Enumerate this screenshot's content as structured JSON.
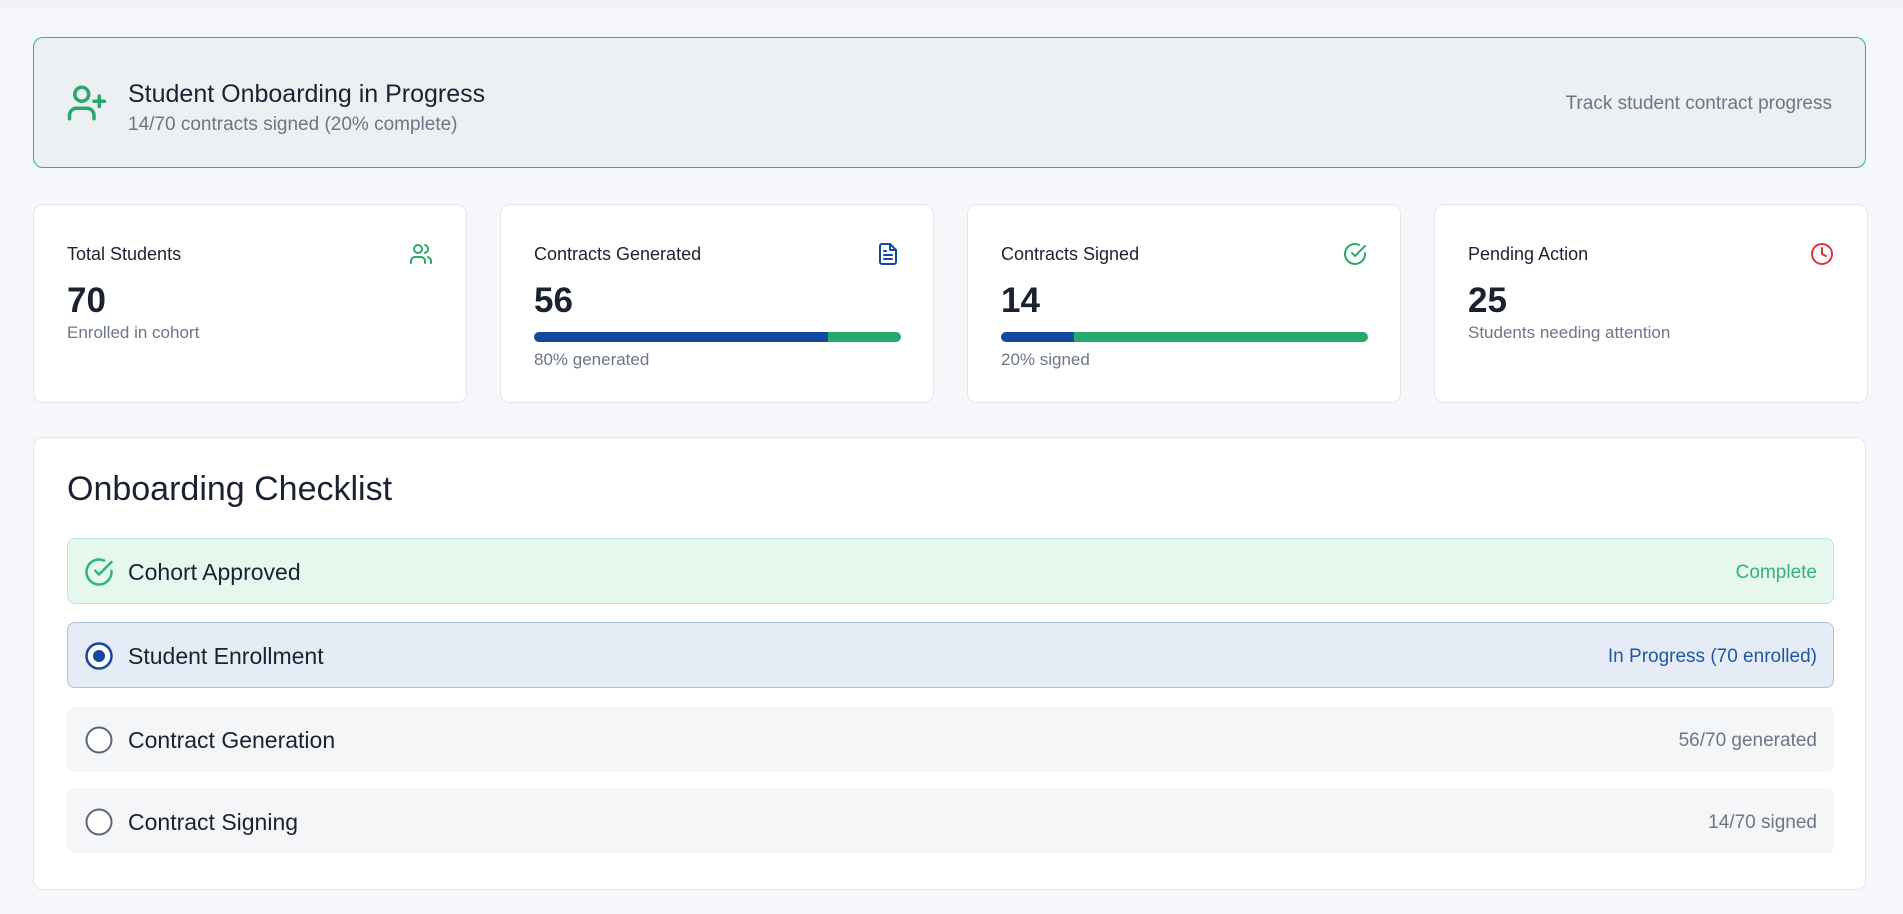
{
  "banner": {
    "icon": "user-plus-icon",
    "title": "Student Onboarding in Progress",
    "subtitle": "14/70 contracts signed (20% complete)",
    "right_text": "Track student contract progress",
    "accent_color": "#33b27f"
  },
  "stats": [
    {
      "label": "Total Students",
      "icon": "users-icon",
      "icon_color": "#28a96c",
      "value": "70",
      "caption": "Enrolled in cohort"
    },
    {
      "label": "Contracts Generated",
      "icon": "document-icon",
      "icon_color": "#1448a0",
      "value": "56",
      "progress_percent": 80,
      "caption": "80% generated"
    },
    {
      "label": "Contracts Signed",
      "icon": "check-circle-icon",
      "icon_color": "#28a96c",
      "value": "14",
      "progress_percent": 20,
      "caption": "20% signed"
    },
    {
      "label": "Pending Action",
      "icon": "clock-icon",
      "icon_color": "#e0333a",
      "value": "25",
      "caption": "Students needing attention"
    }
  ],
  "checklist": {
    "title": "Onboarding Checklist",
    "items": [
      {
        "label": "Cohort Approved",
        "status": "Complete",
        "state": "complete",
        "icon": "check-circle-icon"
      },
      {
        "label": "Student Enrollment",
        "status": "In Progress (70 enrolled)",
        "state": "in-progress",
        "icon": "radio-selected-icon"
      },
      {
        "label": "Contract Generation",
        "status": "56/70 generated",
        "state": "pending",
        "icon": "empty-circle-icon"
      },
      {
        "label": "Contract Signing",
        "status": "14/70 signed",
        "state": "pending",
        "icon": "empty-circle-icon"
      }
    ]
  },
  "colors": {
    "bar_primary": "#1448a0",
    "bar_secondary": "#28a96c",
    "complete": "#33b27f",
    "in_progress": "#1f56a8",
    "pending": "#6b7686"
  }
}
